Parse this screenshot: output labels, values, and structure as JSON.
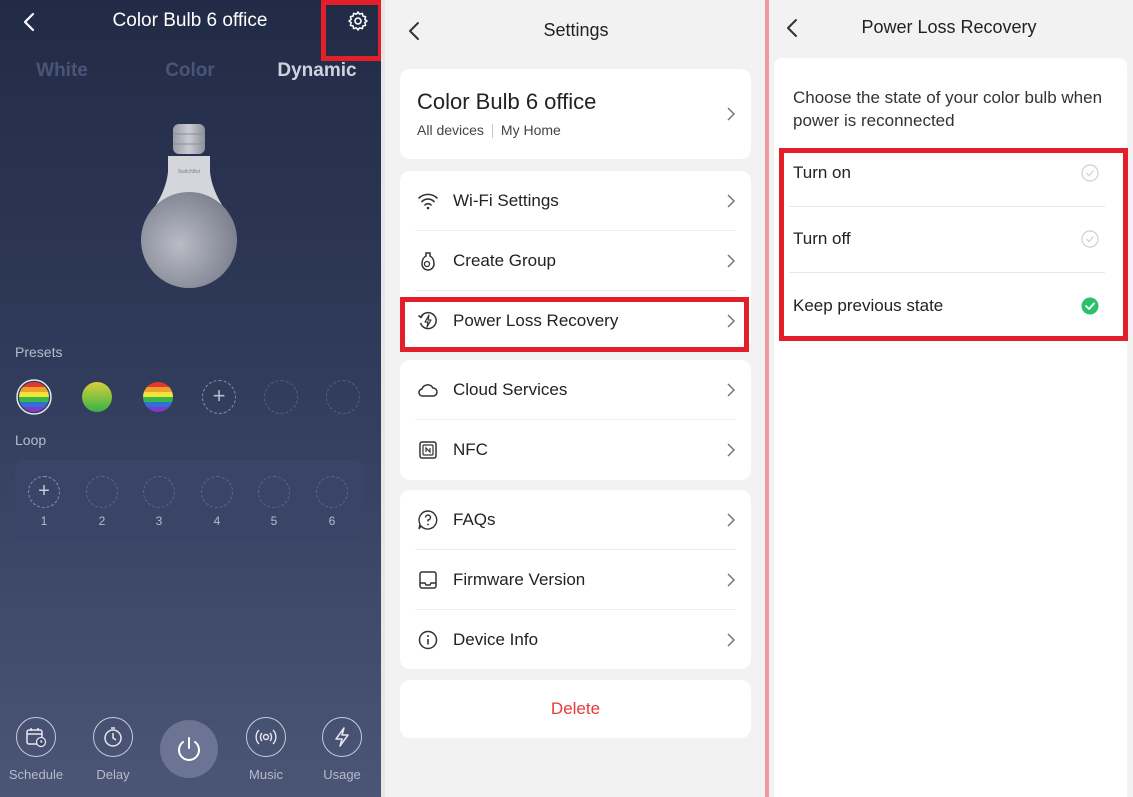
{
  "device_screen": {
    "title": "Color Bulb 6 office",
    "tabs": [
      {
        "label": "White"
      },
      {
        "label": "Color"
      },
      {
        "label": "Dynamic"
      }
    ],
    "bulb_brand": "SwitchBot",
    "presets_label": "Presets",
    "loop_label": "Loop",
    "loop_numbers": [
      "1",
      "2",
      "3",
      "4",
      "5",
      "6"
    ],
    "bottom_bar": {
      "schedule": "Schedule",
      "delay": "Delay",
      "music": "Music",
      "usage": "Usage"
    }
  },
  "settings_screen": {
    "title": "Settings",
    "device": {
      "name": "Color Bulb 6 office",
      "group": "All devices",
      "home": "My Home"
    },
    "rows": {
      "wifi": "Wi-Fi Settings",
      "create_group": "Create Group",
      "power_loss": "Power Loss Recovery",
      "cloud": "Cloud Services",
      "nfc": "NFC",
      "faqs": "FAQs",
      "firmware": "Firmware Version",
      "device_info": "Device Info"
    },
    "delete_label": "Delete"
  },
  "power_loss_screen": {
    "title": "Power Loss Recovery",
    "description": "Choose the state of your color bulb when power is reconnected",
    "options": [
      {
        "label": "Turn on",
        "selected": false
      },
      {
        "label": "Turn off",
        "selected": false
      },
      {
        "label": "Keep previous state",
        "selected": true
      }
    ]
  },
  "colors": {
    "highlight": "#e3202a",
    "selected_check": "#2bc16b",
    "delete_text": "#e5393b"
  }
}
